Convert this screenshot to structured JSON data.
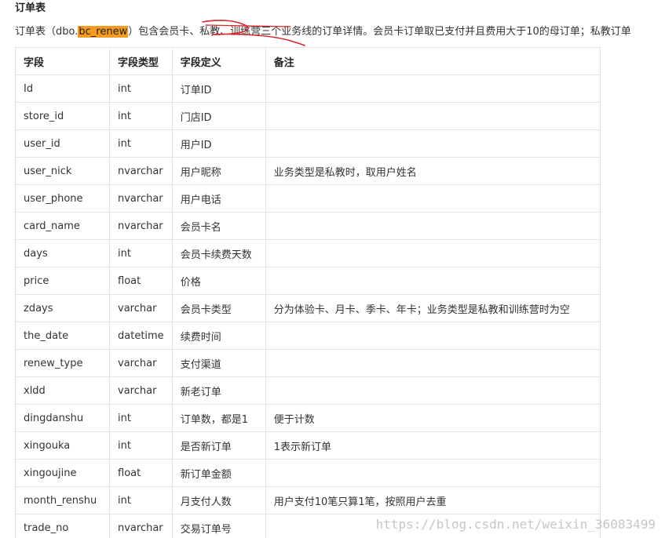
{
  "title": "订单表",
  "intro": {
    "prefix": "订单表（dbo.",
    "highlight": "bc_renew",
    "suffix": "）包含会员卡、私教、训练营三个业务线的订单详情。会员卡订单取已支付并且费用大于10的母订单；私教订单"
  },
  "table": {
    "headers": [
      "字段",
      "字段类型",
      "字段定义",
      "备注"
    ],
    "rows": [
      [
        "Id",
        "int",
        "订单ID",
        ""
      ],
      [
        "store_id",
        "int",
        "门店ID",
        ""
      ],
      [
        "user_id",
        "int",
        "用户ID",
        ""
      ],
      [
        "user_nick",
        "nvarchar",
        "用户昵称",
        "业务类型是私教时，取用户姓名"
      ],
      [
        "user_phone",
        "nvarchar",
        "用户电话",
        ""
      ],
      [
        "card_name",
        "nvarchar",
        "会员卡名",
        ""
      ],
      [
        "days",
        "int",
        "会员卡续费天数",
        ""
      ],
      [
        "price",
        "float",
        "价格",
        ""
      ],
      [
        "zdays",
        "varchar",
        "会员卡类型",
        "分为体验卡、月卡、季卡、年卡；业务类型是私教和训练营时为空"
      ],
      [
        "the_date",
        "datetime",
        "续费时间",
        ""
      ],
      [
        "renew_type",
        "varchar",
        "支付渠道",
        ""
      ],
      [
        "xldd",
        "varchar",
        "新老订单",
        ""
      ],
      [
        "dingdanshu",
        "int",
        "订单数，都是1",
        "便于计数"
      ],
      [
        "xingouka",
        "int",
        "是否新订单",
        "1表示新订单"
      ],
      [
        "xingoujine",
        "float",
        "新订单金额",
        ""
      ],
      [
        "month_renshu",
        "int",
        "月支付人数",
        "用户支付10笔只算1笔，按照用户去重"
      ],
      [
        "trade_no",
        "nvarchar",
        "交易订单号",
        ""
      ]
    ]
  },
  "watermark": "https://blog.csdn.net/weixin_36083499",
  "colors": {
    "highlight": "#f59a23",
    "annotation_stroke": "#d9262b",
    "border": "#e3e3e3"
  }
}
